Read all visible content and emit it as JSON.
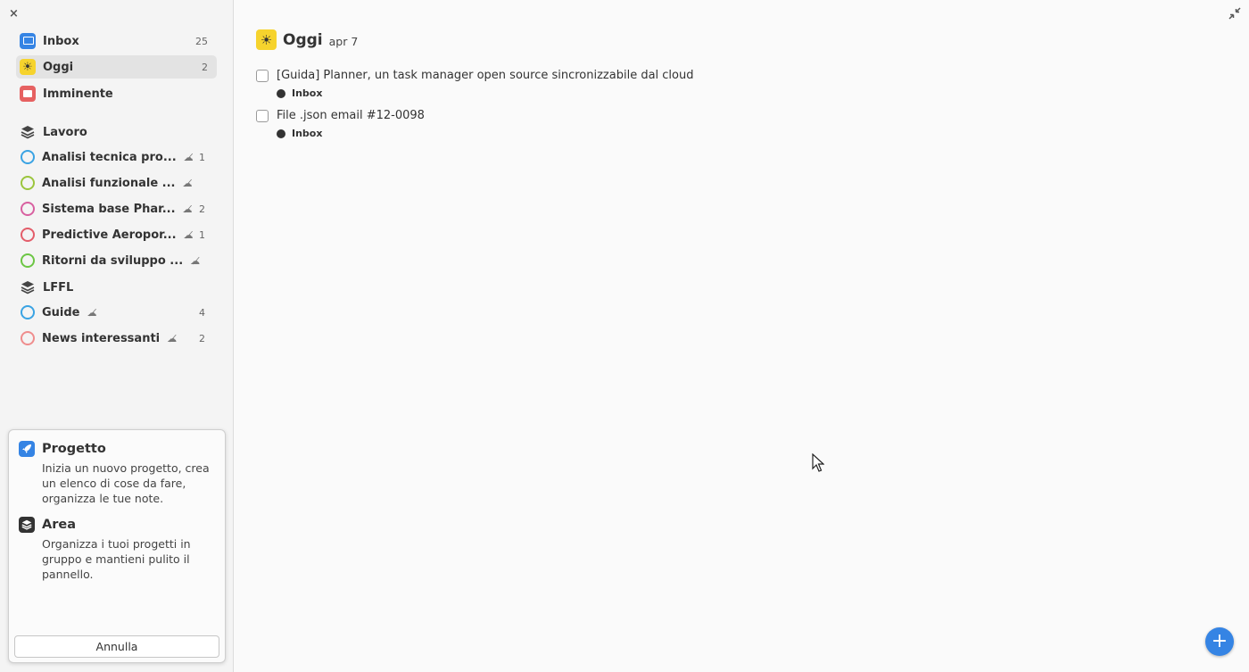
{
  "window": {
    "close_label": "×",
    "shrink_icon": "shrink-icon"
  },
  "nav": [
    {
      "label": "Inbox",
      "count": "25",
      "icon": "inbox-icon"
    },
    {
      "label": "Oggi",
      "count": "2",
      "icon": "sun-icon"
    },
    {
      "label": "Imminente",
      "count": "",
      "icon": "calendar-icon"
    }
  ],
  "areas": [
    {
      "label": "Lavoro",
      "projects": [
        {
          "label": "Analisi tecnica pro...",
          "count": "1",
          "color": "#3aa3e3"
        },
        {
          "label": "Analisi funzionale ...",
          "count": "",
          "color": "#9bc53d"
        },
        {
          "label": "Sistema base Phar...",
          "count": "2",
          "color": "#d860a0"
        },
        {
          "label": "Predictive Aeropor...",
          "count": "1",
          "color": "#e35d6a"
        },
        {
          "label": "Ritorni da sviluppo ...",
          "count": "",
          "color": "#6cc644"
        }
      ]
    },
    {
      "label": "LFFL",
      "projects": [
        {
          "label": "Guide",
          "count": "4",
          "color": "#3aa3e3"
        },
        {
          "label": "News interessanti",
          "count": "2",
          "color": "#ef8d8d"
        }
      ]
    }
  ],
  "popover": {
    "project_title": "Progetto",
    "project_desc": "Inizia un nuovo progetto, crea un elenco di cose da fare, organizza le tue note.",
    "area_title": "Area",
    "area_desc": "Organizza i tuoi progetti in gruppo e mantieni pulito il pannello.",
    "cancel_label": "Annulla",
    "project_color": "#3584e4",
    "area_color": "#333333"
  },
  "main": {
    "title": "Oggi",
    "date": "apr 7",
    "tasks": [
      {
        "text": "[Guida] Planner, un task manager open source sincronizzabile dal cloud",
        "project": "Inbox"
      },
      {
        "text": "File .json email #12-0098",
        "project": "Inbox"
      }
    ],
    "add_label": "+"
  },
  "colors": {
    "accent": "#3584e4",
    "today": "#f6d32d",
    "upcoming": "#e66161"
  }
}
